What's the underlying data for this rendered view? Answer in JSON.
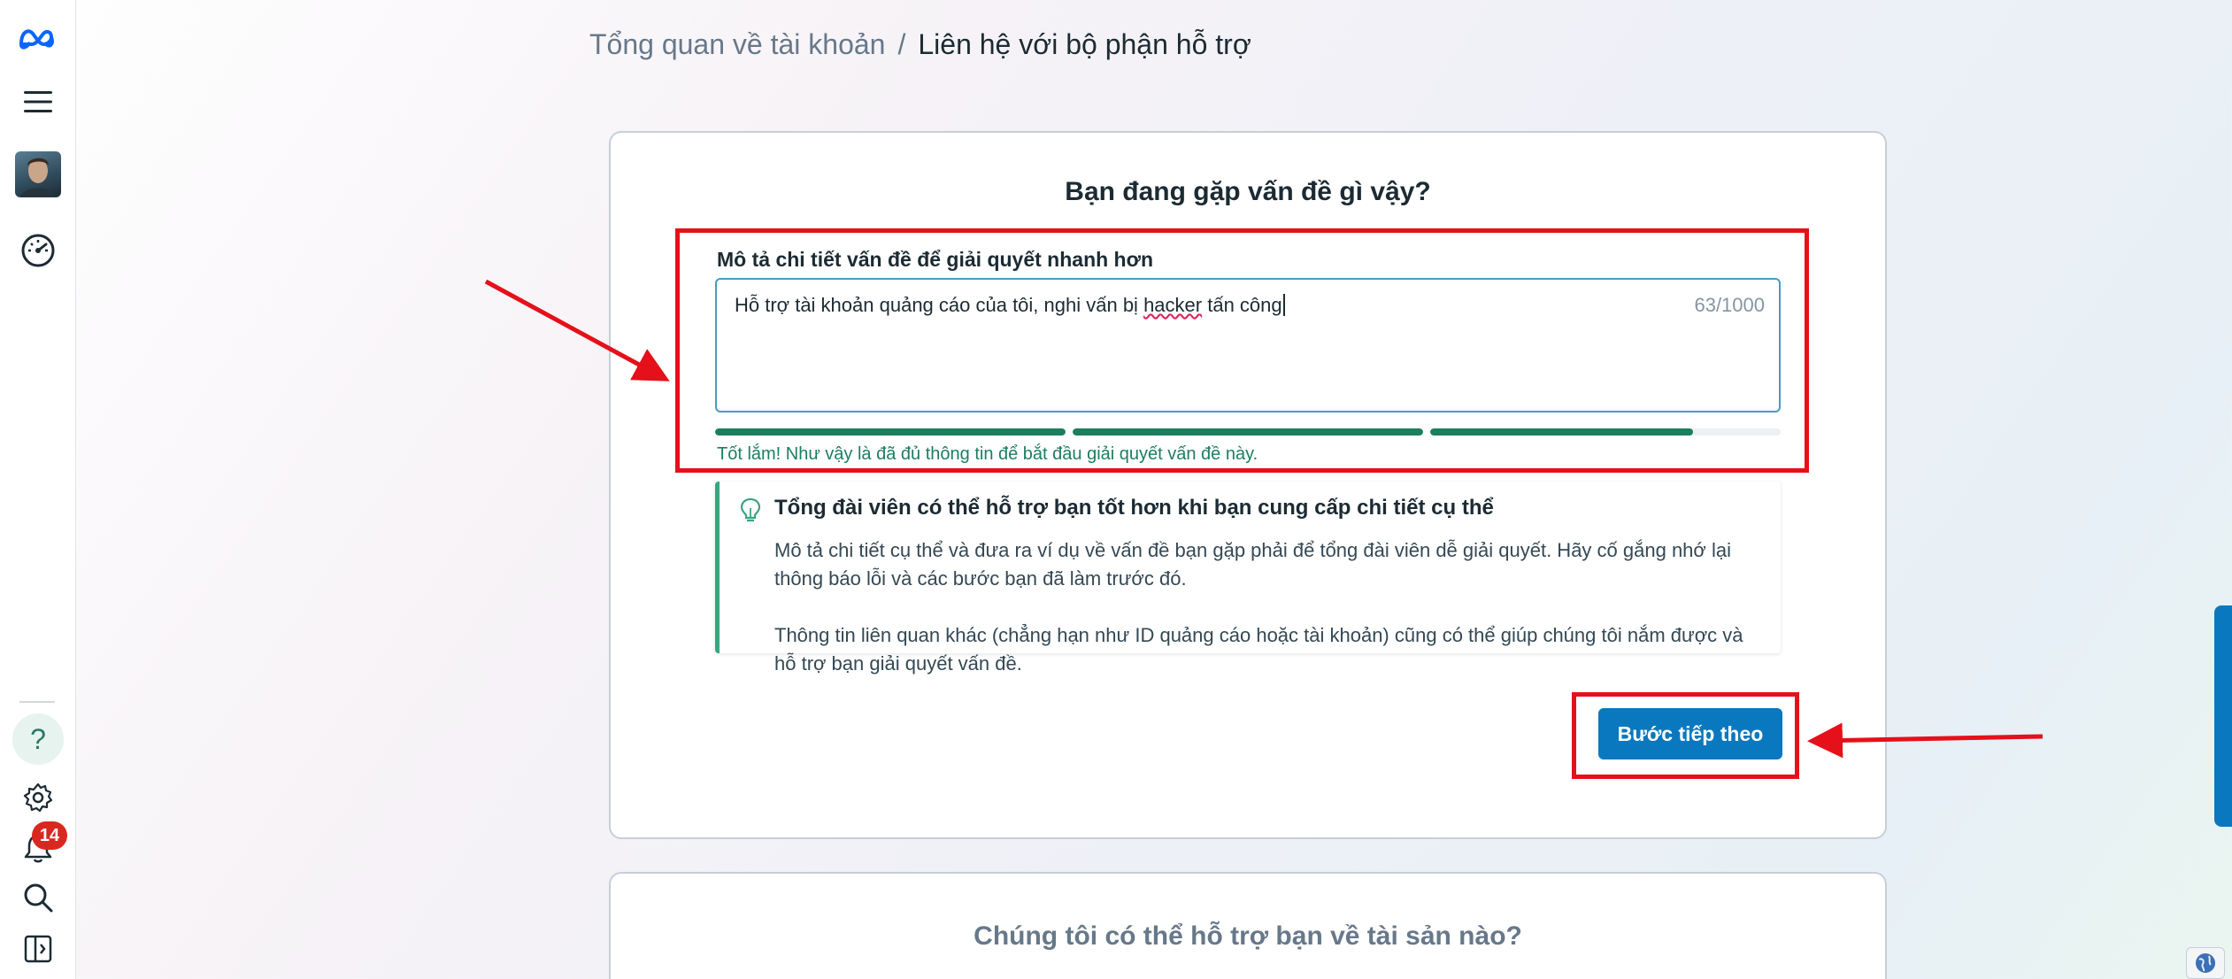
{
  "breadcrumb": {
    "parent": "Tổng quan về tài khoản",
    "separator": "/",
    "current": "Liên hệ với bộ phận hỗ trợ"
  },
  "sidebar": {
    "top_icons": [
      "meta-logo-icon",
      "menu-icon",
      "avatar",
      "dashboard-icon"
    ],
    "bottom_icons": [
      "help-icon",
      "settings-icon",
      "notifications-icon",
      "search-icon",
      "panel-toggle-icon"
    ],
    "help_symbol": "?",
    "notification_count": "14"
  },
  "main_card": {
    "title": "Bạn đang gặp vấn đề gì vậy?",
    "field_label": "Mô tả chi tiết vấn đề để giải quyết nhanh hơn",
    "textarea": {
      "value_before": "Hỗ trợ tài khoản quảng cáo của tôi, nghi vấn bị ",
      "value_misspelled": "hacker",
      "value_after": " tấn công",
      "char_count": "63/1000"
    },
    "progress": {
      "segments": [
        1,
        1,
        0.75
      ],
      "message": "Tốt lắm! Như vậy là đã đủ thông tin để bắt đầu giải quyết vấn đề này.",
      "color": "#1b7f5e"
    },
    "tip": {
      "icon": "lightbulb-icon",
      "title": "Tổng đài viên có thể hỗ trợ bạn tốt hơn khi bạn cung cấp chi tiết cụ thể",
      "paragraph1": "Mô tả chi tiết cụ thể và đưa ra ví dụ về vấn đề bạn gặp phải để tổng đài viên dễ giải quyết. Hãy cố gắng nhớ lại thông báo lỗi và các bước bạn đã làm trước đó.",
      "paragraph2": "Thông tin liên quan khác (chẳng hạn như ID quảng cáo hoặc tài khoản) cũng có thể giúp chúng tôi nắm được và hỗ trợ bạn giải quyết vấn đề."
    },
    "next_button": "Bước tiếp theo"
  },
  "second_card": {
    "title": "Chúng tôi có thể hỗ trợ bạn về tài sản nào?"
  },
  "colors": {
    "accent": "#0a78be",
    "success": "#1b7f5e",
    "annotation": "#e5101a",
    "badge": "#d9281f"
  }
}
